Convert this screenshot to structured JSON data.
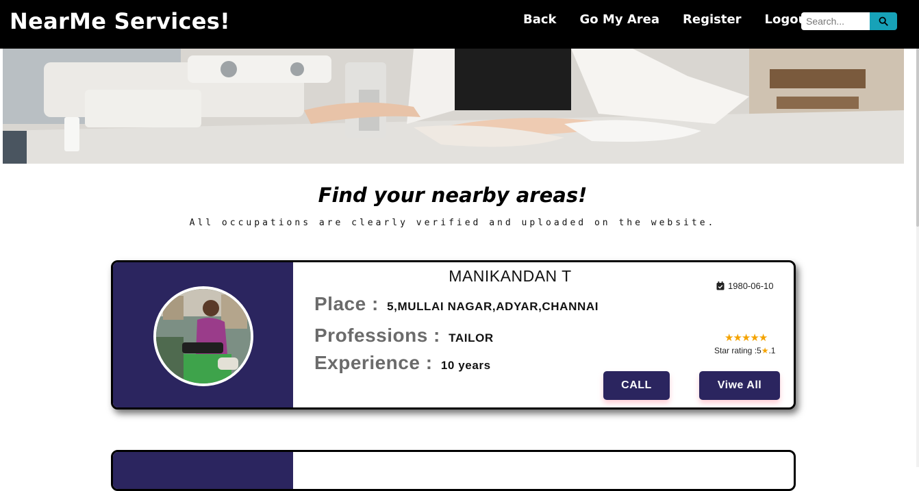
{
  "navbar": {
    "brand": "NearMe Services!",
    "links": [
      "Back",
      "Go My Area",
      "Register",
      "Logout"
    ],
    "search": {
      "placeholder": "Search..."
    }
  },
  "heading": {
    "title": "Find your nearby areas!",
    "subtitle": "All occupations are clearly verified and uploaded on the website."
  },
  "cards": [
    {
      "name": "MANIKANDAN T",
      "date": "1980-06-10",
      "place_label": "Place :",
      "place": "5,MULLAI NAGAR,ADYAR,CHANNAI",
      "profession_label": "Professions :",
      "profession": "TAILOR",
      "experience_label": "Experience :",
      "experience": "10 years",
      "stars": 5,
      "star_rating_label": "Star rating :5",
      "star_rating_suffix": ".1",
      "call_label": "CALL",
      "view_label": "Viwe All"
    }
  ],
  "colors": {
    "navbar_bg": "#000000",
    "search_button": "#17a2b8",
    "card_panel": "#2b255f",
    "star": "#f4a300"
  }
}
